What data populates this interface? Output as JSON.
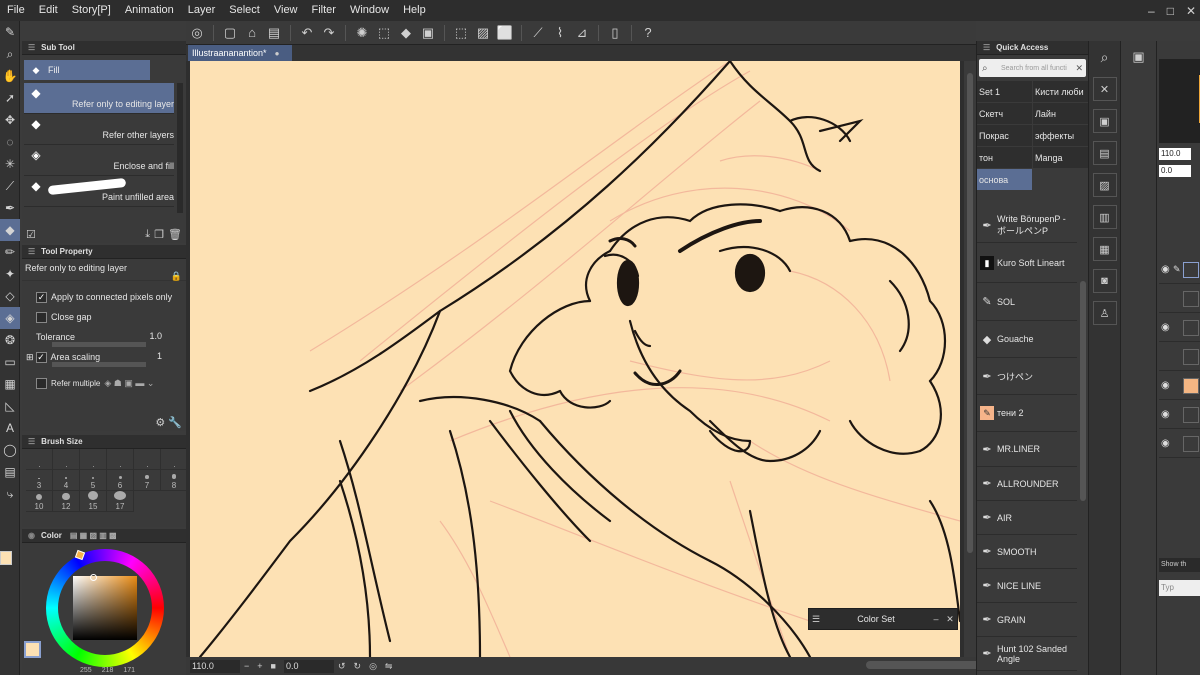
{
  "menu": [
    "File",
    "Edit",
    "Story[P]",
    "Animation",
    "Layer",
    "Select",
    "View",
    "Filter",
    "Window",
    "Help"
  ],
  "window_controls": {
    "minimize": "–",
    "maximize": "□",
    "close": "✕"
  },
  "document": {
    "tab_title": "Illustraananantion*",
    "modified_dot": "●"
  },
  "subtool": {
    "header": "Sub Tool",
    "group_tab": "Fill",
    "items": [
      {
        "label": "Refer only to editing layer",
        "icon": "bucket-icon",
        "selected": true
      },
      {
        "label": "Refer other layers",
        "icon": "bucket-icon",
        "selected": false
      },
      {
        "label": "Enclose and fill",
        "icon": "bucket-lasso-icon",
        "selected": false
      },
      {
        "label": "Paint unfilled area",
        "icon": "bucket-brush-icon",
        "selected": false
      }
    ]
  },
  "tool_property": {
    "header": "Tool Property",
    "tool_name": "Refer only to editing layer",
    "apply_connected": "Apply to connected pixels only",
    "close_gap": "Close gap",
    "tolerance_label": "Tolerance",
    "tolerance_value": "1.0",
    "area_scaling_label": "Area scaling",
    "area_scaling_value": "1",
    "refer_multiple_label": "Refer multiple"
  },
  "brush_size": {
    "header": "Brush Size",
    "sizes": [
      "3",
      "4",
      "5",
      "6",
      "7",
      "8",
      "10",
      "12",
      "15",
      "17"
    ]
  },
  "color": {
    "header": "Color",
    "main": "#fde1b4",
    "rgb": [
      "255",
      "218",
      "171"
    ]
  },
  "quick_access": {
    "header": "Quick Access",
    "search_placeholder": "Search from all functi",
    "sets": [
      {
        "label": "Set 1",
        "selected": false
      },
      {
        "label": "Кисти люби",
        "selected": false
      },
      {
        "label": "Скетч",
        "selected": false
      },
      {
        "label": "Лайн",
        "selected": false
      },
      {
        "label": "Покрас",
        "selected": false
      },
      {
        "label": "эффекты",
        "selected": false
      },
      {
        "label": "тон",
        "selected": false
      },
      {
        "label": "Manga",
        "selected": false
      },
      {
        "label": "основа",
        "selected": true
      }
    ],
    "brushes": [
      {
        "label": "Write BörupenP - ボールペンP",
        "icon": "pen-icon"
      },
      {
        "label": "Kuro Soft Lineart",
        "icon": "black-brush-icon"
      },
      {
        "label": "SOL",
        "icon": "marker-icon"
      },
      {
        "label": "Gouache",
        "icon": "gouache-icon"
      },
      {
        "label": "つけペン",
        "icon": "pen-icon"
      },
      {
        "label": "тени 2",
        "icon": "peach-brush-icon"
      },
      {
        "label": "MR.LINER",
        "icon": "pen-icon"
      },
      {
        "label": "ALLROUNDER",
        "icon": "pen-icon"
      },
      {
        "label": "AIR",
        "icon": "pen-icon"
      },
      {
        "label": "SMOOTH",
        "icon": "pen-icon"
      },
      {
        "label": "NICE LINE",
        "icon": "pen-icon"
      },
      {
        "label": "GRAIN",
        "icon": "pen-icon"
      },
      {
        "label": "Hunt 102 Sanded Angle",
        "icon": "pen-icon"
      }
    ]
  },
  "color_set": {
    "title": "Color Set"
  },
  "status": {
    "zoom": "110.0",
    "angle": "0.0"
  },
  "layers": {
    "opacity_field": "110.0",
    "angle_field": "0.0",
    "show_label": "Show th",
    "search_placeholder": "Typ"
  },
  "accent": "#5b6e94",
  "canvas_bg": "#fde1b4"
}
